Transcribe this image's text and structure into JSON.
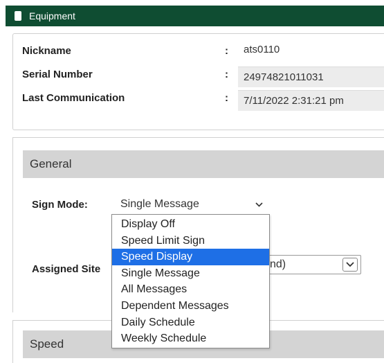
{
  "header": {
    "title": "Equipment",
    "icon": "equipment-chip-icon"
  },
  "details": [
    {
      "label": "Nickname",
      "value": "ats0110",
      "readonly": false
    },
    {
      "label": "Serial Number",
      "value": "24974821011031",
      "readonly": true
    },
    {
      "label": "Last Communication",
      "value": "7/11/2022 2:31:21 pm",
      "readonly": true
    }
  ],
  "colon": ":",
  "general": {
    "heading": "General",
    "sign_mode_label": "Sign Mode:",
    "sign_mode_value": "Single Message",
    "assigned_site_label": "Assigned Site",
    "assigned_site_value": "nd)",
    "options": [
      "Display Off",
      "Speed Limit Sign",
      "Speed Display",
      "Single Message",
      "All Messages",
      "Dependent Messages",
      "Daily Schedule",
      "Weekly Schedule"
    ],
    "highlighted_option": "Speed Display"
  },
  "speed": {
    "heading": "Speed"
  },
  "colors": {
    "header_bg": "#0f4d32",
    "highlight": "#1e6fe6",
    "section_bg": "#d4d4d4"
  }
}
